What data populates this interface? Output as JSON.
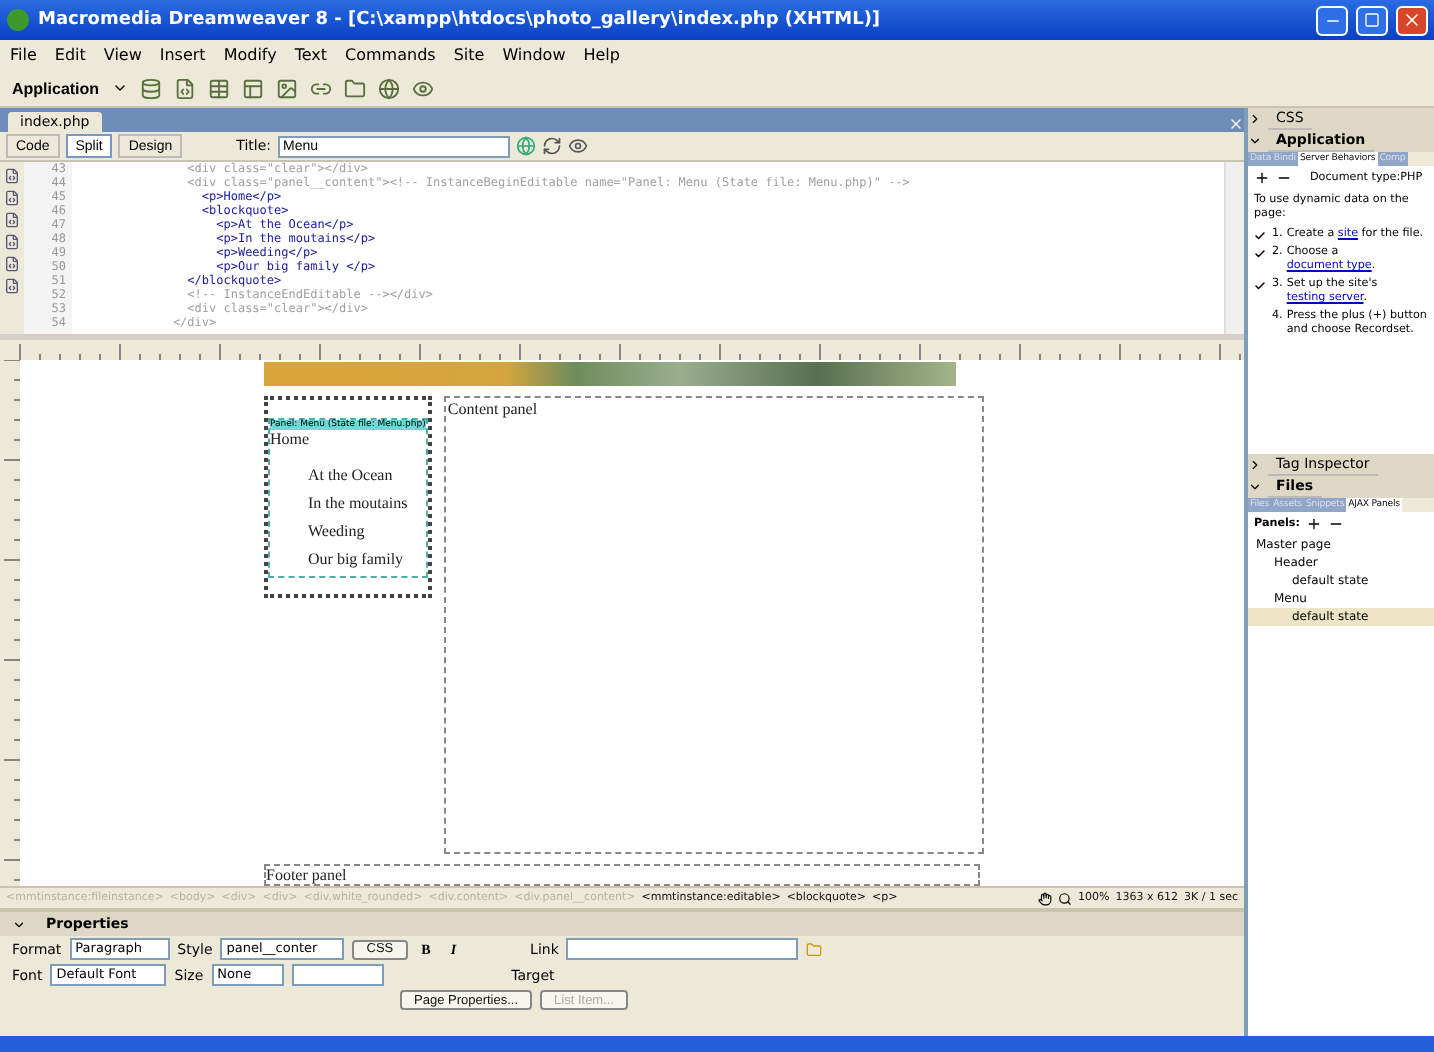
{
  "window": {
    "title": "Macromedia Dreamweaver 8 - [C:\\xampp\\htdocs\\photo_gallery\\index.php (XHTML)]"
  },
  "menu": [
    "File",
    "Edit",
    "View",
    "Insert",
    "Modify",
    "Text",
    "Commands",
    "Site",
    "Window",
    "Help"
  ],
  "toolbar": {
    "workspace": "Application"
  },
  "document": {
    "tab": "index.php",
    "views": [
      {
        "label": "Code",
        "selected": false
      },
      {
        "label": "Split",
        "selected": true
      },
      {
        "label": "Design",
        "selected": false
      }
    ],
    "title_label": "Title:",
    "title_value": "Menu"
  },
  "code": [
    {
      "number": "43",
      "text": "      <div class=\"clear\"></div>",
      "locked": true
    },
    {
      "number": "44",
      "text": "      <div class=\"panel__content\"><!-- InstanceBeginEditable name=\"Panel: Menu (State file: Menu.php)\" -->",
      "locked": true
    },
    {
      "number": "45",
      "text": "        <p>Home</p>",
      "locked": false
    },
    {
      "number": "46",
      "text": "        <blockquote>",
      "locked": false
    },
    {
      "number": "47",
      "text": "          <p>At the Ocean</p>",
      "locked": false
    },
    {
      "number": "48",
      "text": "          <p>In the moutains</p>",
      "locked": false
    },
    {
      "number": "49",
      "text": "          <p>Weeding</p>",
      "locked": false
    },
    {
      "number": "50",
      "text": "          <p>Our big family </p>",
      "locked": false
    },
    {
      "number": "51",
      "text": "      </blockquote>",
      "locked": false
    },
    {
      "number": "52",
      "text": "      <!-- InstanceEndEditable --></div>",
      "locked": true
    },
    {
      "number": "53",
      "text": "      <div class=\"clear\"></div>",
      "locked": true
    },
    {
      "number": "54",
      "text": "    </div>",
      "locked": true
    }
  ],
  "design": {
    "panel_tag": "Panel: Menu (State file: Menu.php)",
    "home": "Home",
    "items": [
      "At the Ocean",
      "In the moutains",
      "Weeding",
      "Our big family"
    ],
    "content_panel": "Content panel",
    "footer_panel": "Footer panel"
  },
  "status_bar": {
    "tags": [
      {
        "label": "<mmtinstance:fileinstance>",
        "disabled": true
      },
      {
        "label": "<body>",
        "disabled": true
      },
      {
        "label": "<div>",
        "disabled": true
      },
      {
        "label": "<div>",
        "disabled": true
      },
      {
        "label": "<div.white_rounded>",
        "disabled": true
      },
      {
        "label": "<div.content>",
        "disabled": true
      },
      {
        "label": "<div.panel__content>",
        "disabled": true
      },
      {
        "label": "<mmtinstance:editable>",
        "disabled": false
      },
      {
        "label": "<blockquote>",
        "disabled": false
      },
      {
        "label": "<p>",
        "disabled": false
      }
    ],
    "zoom": "100%",
    "size": "1363 x 612",
    "download": "3K / 1 sec"
  },
  "properties": {
    "title": "Properties",
    "format_label": "Format",
    "format": "Paragraph",
    "style_label": "Style",
    "style": "panel__conter",
    "css": "CSS",
    "bold": "B",
    "italic": "I",
    "link_label": "Link",
    "font_label": "Font",
    "font": "Default Font",
    "size_label": "Size",
    "size": "None",
    "target_label": "Target",
    "page_properties": "Page Properties...",
    "list_item": "List Item..."
  },
  "side": {
    "css": "CSS",
    "application": "Application",
    "app_tabs": [
      {
        "label": "Data Bindi",
        "selected": false
      },
      {
        "label": "Server Behaviors",
        "selected": true
      },
      {
        "label": "Comp",
        "selected": false
      }
    ],
    "doc_type": "Document type:PHP",
    "intro": "To use dynamic data on the page:",
    "steps": [
      {
        "number": "1.",
        "before": "Create a",
        "link": "site",
        "after": "for the file.",
        "done": true
      },
      {
        "number": "2.",
        "before": "Choose a",
        "link": "document type",
        "after": ".",
        "done": true
      },
      {
        "number": "3.",
        "before": "Set up the site's",
        "link": "testing server",
        "after": ".",
        "done": true
      },
      {
        "number": "4.",
        "before": "Press the plus (+) button and choose Recordset.",
        "done": false
      }
    ],
    "tag_inspector": "Tag Inspector",
    "files": "Files",
    "files_tabs": [
      {
        "label": "Files",
        "selected": false
      },
      {
        "label": "Assets",
        "selected": false
      },
      {
        "label": "Snippets",
        "selected": false
      },
      {
        "label": "AJAX Panels",
        "selected": true
      }
    ],
    "panels_label": "Panels:",
    "tree": [
      {
        "label": "Master page",
        "selected": false,
        "children": [
          {
            "label": "Header",
            "selected": false,
            "children": [
              {
                "label": "default state",
                "selected": false
              }
            ]
          },
          {
            "label": "Menu",
            "selected": false,
            "children": [
              {
                "label": "default state",
                "selected": true
              }
            ]
          }
        ]
      }
    ]
  }
}
